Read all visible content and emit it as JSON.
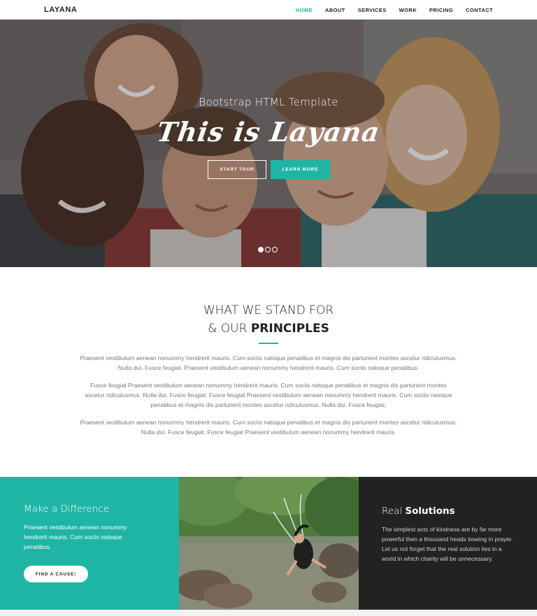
{
  "navbar": {
    "brand": "LAYANA",
    "items": [
      {
        "label": "HOME",
        "active": true
      },
      {
        "label": "ABOUT",
        "active": false
      },
      {
        "label": "SERVICES",
        "active": false
      },
      {
        "label": "WORK",
        "active": false
      },
      {
        "label": "PRICING",
        "active": false
      },
      {
        "label": "CONTACT",
        "active": false
      }
    ]
  },
  "hero": {
    "subtitle": "Bootstrap HTML Template",
    "title": "This is Layana",
    "buttons": {
      "start_tour": "START TOUR",
      "learn_more": "LEARN MORE"
    },
    "slides": 3,
    "active_slide": 1
  },
  "principles": {
    "title_line1": "WHAT WE STAND FOR",
    "title_line2_prefix": "& OUR ",
    "title_line2_bold": "PRINCIPLES",
    "paragraphs": [
      "Praesent vestibulum aenean nonummy hendrerit mauris. Cum sociis natoque penatibus et magnis dis parturient montes ascetur ridiculusmus. Nulla dui. Fusce feugiat. Praesent vestibulum aenean nonummy hendrerit mauris. Cum sociis natoque penatibus.",
      "Fusce feugiat Praesent vestibulum aenean nonummy hendrerit mauris. Cum sociis natoque penatibus et magnis dis parturient montes ascetur ridiculusmus. Nulla dui. Fusce feugiat. Fusce feugiat Praesent vestibulum aenean nonummy hendrerit mauris. Cum sociis natoque penatibus et magnis dis parturient montes ascetur ridiculusmus. Nulla dui. Fusce feugiat.",
      "Praesent vestibulum aenean nonummy hendrerit mauris. Cum sociis natoque penatibus et magnis dis parturient montes ascetur ridiculusmus. Nulla dui. Fusce feugiat. Fusce feugiat Praesent vestibulum aenean nonummy hendrerit mauris."
    ]
  },
  "difference": {
    "title": "Make a Difference",
    "text": "Praesent vestibulum aenean nonummy hendrerit mauris. Cum sociis natoque penatibus.",
    "button": "FIND A CAUSE!"
  },
  "solutions": {
    "title_prefix": "Real ",
    "title_bold": "Solutions",
    "text": "The simplest acts of kindness are by far more powerful then a thousand heads bowing in prayer. Let us not forget that the real solution lies in a world in which charity will be unnecessary."
  },
  "colors": {
    "accent": "#1fb5a5",
    "dark": "#222222",
    "text": "#777777"
  }
}
